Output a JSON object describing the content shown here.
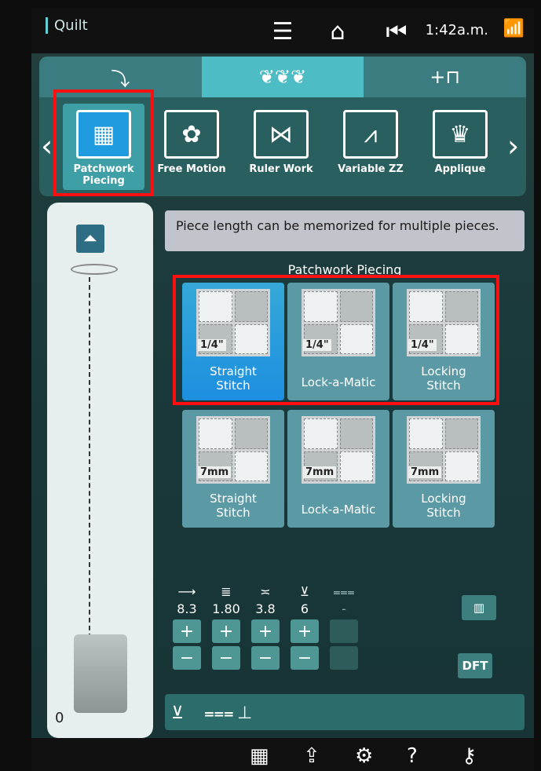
{
  "app": {
    "title": "Quilt",
    "time": "1:42a.m."
  },
  "topbar": {
    "icons": [
      "menu-icon",
      "home-icon",
      "back-to-start-icon",
      "wifi-icon"
    ]
  },
  "tabs": [
    {
      "name": "stitch-tab",
      "icon": "needle-icon",
      "glyph": "⤵"
    },
    {
      "name": "embroidery-tab",
      "icon": "embroidery-icon",
      "glyph": "❦❦❦"
    },
    {
      "name": "add-tab",
      "icon": "add-presser-foot-icon",
      "glyph": "+⊓"
    }
  ],
  "categories": [
    {
      "label": "Patchwork Piecing",
      "glyph": "▦"
    },
    {
      "label": "Free Motion",
      "glyph": "✿"
    },
    {
      "label": "Ruler Work",
      "glyph": "⋈"
    },
    {
      "label": "Variable ZZ",
      "glyph": "⩘"
    },
    {
      "label": "Applique",
      "glyph": "♛"
    }
  ],
  "info": {
    "message": "Piece length can be memorized for multiple pieces."
  },
  "group": {
    "title": "Patchwork Piecing"
  },
  "stitches": [
    {
      "meas": "1/4\"",
      "line1": "Straight",
      "line2": "Stitch"
    },
    {
      "meas": "1/4\"",
      "line1": "Lock-a-Matic",
      "line2": ""
    },
    {
      "meas": "1/4\"",
      "line1": "Locking",
      "line2": "Stitch"
    },
    {
      "meas": "7mm",
      "line1": "Straight",
      "line2": "Stitch"
    },
    {
      "meas": "7mm",
      "line1": "Lock-a-Matic",
      "line2": ""
    },
    {
      "meas": "7mm",
      "line1": "Locking",
      "line2": "Stitch"
    }
  ],
  "params": [
    {
      "name": "stitch-width",
      "value": "8.3",
      "glyph": "⟶"
    },
    {
      "name": "stitch-length",
      "value": "1.80",
      "glyph": "≣"
    },
    {
      "name": "tension",
      "value": "3.8",
      "glyph": "≍"
    },
    {
      "name": "presser-foot-pressure",
      "value": "6",
      "glyph": "⊻"
    },
    {
      "name": "feed-dogs",
      "value": "-",
      "glyph": "⩶"
    }
  ],
  "buttons": {
    "plus": "+",
    "minus": "−",
    "dft": "DFT"
  }
}
